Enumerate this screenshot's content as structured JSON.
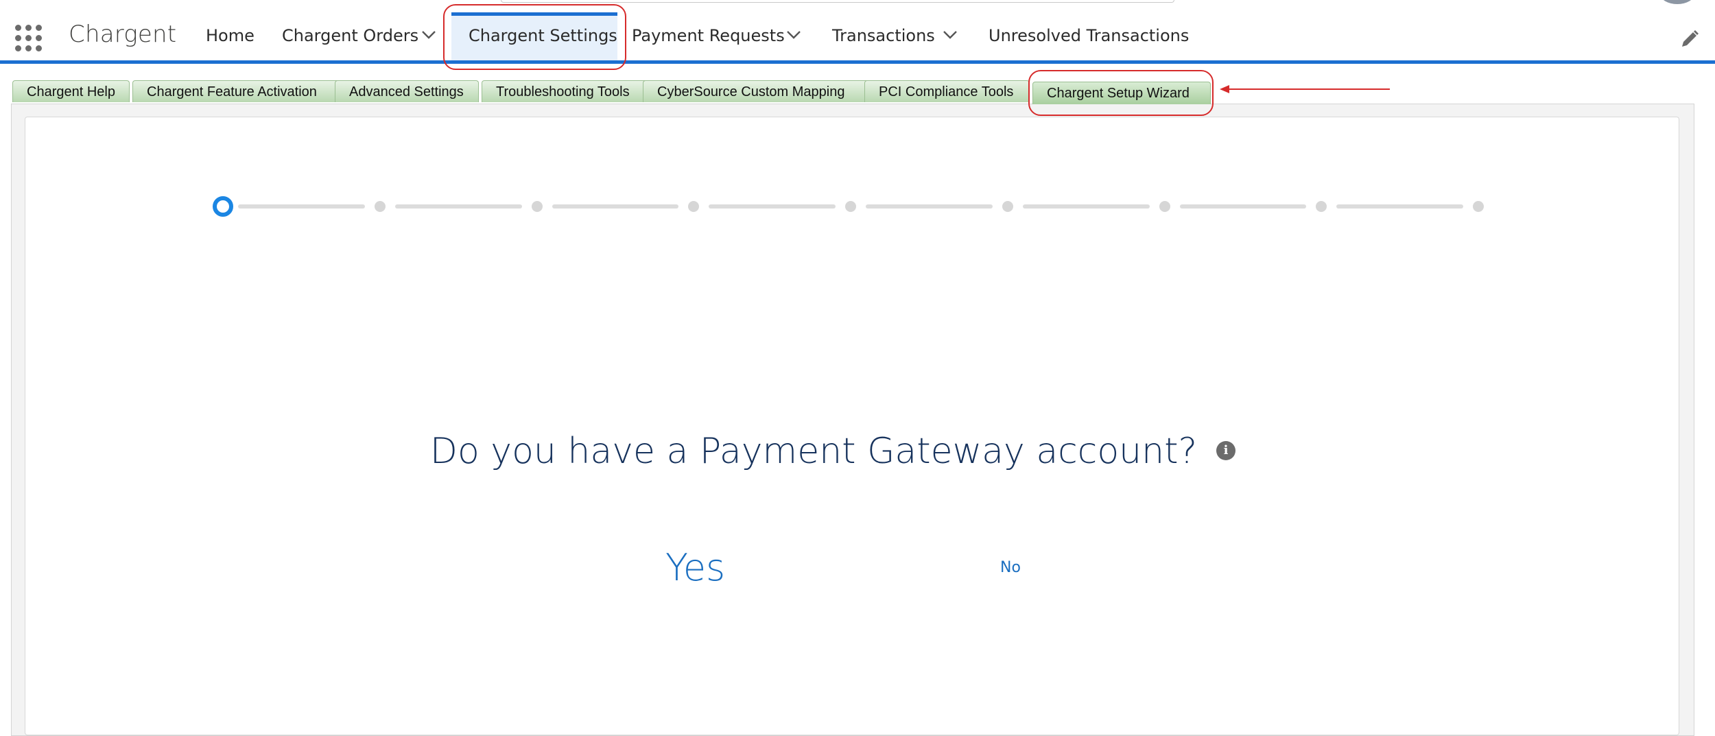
{
  "topbar": {
    "app_name": "Chargent",
    "nav": [
      {
        "label": "Home",
        "has_menu": false
      },
      {
        "label": "Chargent Orders",
        "has_menu": true
      },
      {
        "label": "Chargent Settings",
        "has_menu": false,
        "active": true
      },
      {
        "label": "Payment Requests",
        "has_menu": true
      },
      {
        "label": "Transactions",
        "has_menu": true
      },
      {
        "label": "Unresolved Transactions",
        "has_menu": false
      }
    ]
  },
  "tabs": [
    {
      "label": "Chargent Help"
    },
    {
      "label": "Chargent Feature Activation"
    },
    {
      "label": "Advanced Settings"
    },
    {
      "label": "Troubleshooting Tools"
    },
    {
      "label": "CyberSource Custom Mapping"
    },
    {
      "label": "PCI Compliance Tools"
    },
    {
      "label": "Chargent Setup Wizard",
      "active": true
    }
  ],
  "wizard": {
    "steps_total": 9,
    "current_step": 1,
    "question": "Do you have a Payment Gateway account?",
    "answer_yes": "Yes",
    "answer_no": "No"
  },
  "icons": {
    "launcher": "app-launcher-icon",
    "chevron": "chevron-down-icon",
    "edit": "pencil-icon",
    "info": "info-icon"
  },
  "colors": {
    "brand_blue": "#1b6fd1",
    "question_navy": "#16325c",
    "link_blue": "#1a6ec0",
    "tab_green": "#b9d8b1",
    "annotation_red": "#d62b2b"
  }
}
